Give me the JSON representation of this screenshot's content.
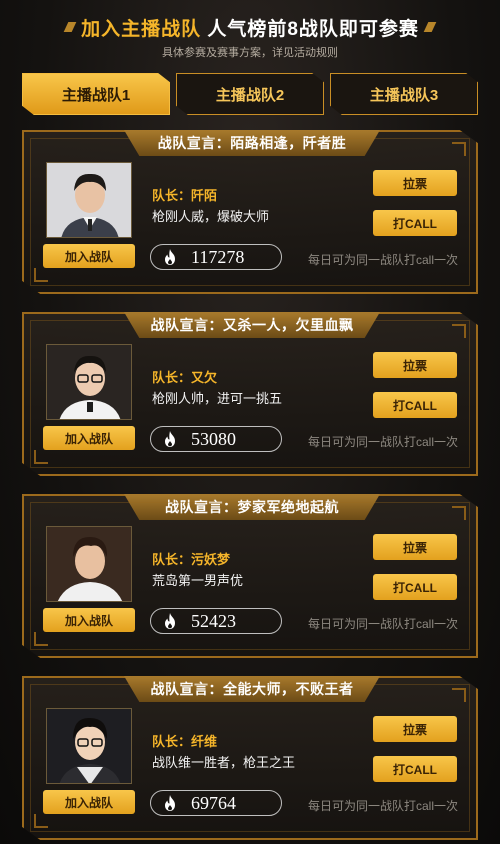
{
  "header": {
    "title_gold": "加入主播战队",
    "title_white": "人气榜前8战队即可参赛",
    "subtitle": "具体参赛及赛事方案，详见活动规则"
  },
  "tabs": [
    {
      "label": "主播战队1",
      "active": true
    },
    {
      "label": "主播战队2",
      "active": false
    },
    {
      "label": "主播战队3",
      "active": false
    }
  ],
  "teams": [
    {
      "motto": "战队宣言：陌路相逢，阡者胜",
      "captain": "队长：阡陌",
      "slogan": "枪刚人威，爆破大师",
      "votes": "117278",
      "join_label": "加入战队",
      "vote_label": "拉票",
      "call_label": "打CALL",
      "note": "每日可为同一战队打call一次"
    },
    {
      "motto": "战队宣言：又杀一人，欠里血飘",
      "captain": "队长：又欠",
      "slogan": "枪刚人帅，进可一挑五",
      "votes": "53080",
      "join_label": "加入战队",
      "vote_label": "拉票",
      "call_label": "打CALL",
      "note": "每日可为同一战队打call一次"
    },
    {
      "motto": "战队宣言：梦家军绝地起航",
      "captain": "队长：污妖梦",
      "slogan": "荒岛第一男声优",
      "votes": "52423",
      "join_label": "加入战队",
      "vote_label": "拉票",
      "call_label": "打CALL",
      "note": "每日可为同一战队打call一次"
    },
    {
      "motto": "战队宣言：全能大师，不败王者",
      "captain": "队长：纤维",
      "slogan": "战队维一胜者，枪王之王",
      "votes": "69764",
      "join_label": "加入战队",
      "vote_label": "拉票",
      "call_label": "打CALL",
      "note": "每日可为同一战队打call一次"
    }
  ],
  "colors": {
    "accent_gold": "#f5b52a",
    "button_gold": "#e3a11e",
    "border_bronze": "#9c6a1c",
    "background": "#141210"
  },
  "icons": {
    "vote_count_icon": "fire-icon"
  }
}
